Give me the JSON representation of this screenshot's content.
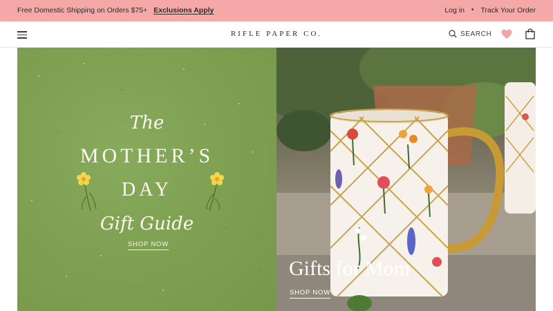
{
  "announcement": {
    "shipping_text": "Free Domestic Shipping on Orders $75+",
    "exclusions_link": "Exclusions Apply",
    "login_link": "Log in",
    "separator": "•",
    "track_order_link": "Track Your Order",
    "background_color": "#f5a8a8"
  },
  "header": {
    "logo": "RIFLE PAPER CO.",
    "search_label": "SEARCH",
    "icons": {
      "menu": "hamburger-menu-icon",
      "search": "search-icon",
      "wishlist": "heart-icon",
      "cart": "shopping-bag-icon"
    },
    "heart_color": "#f2a6a6"
  },
  "hero": {
    "left_panel": {
      "line1": "The",
      "line2": "MOTHER’S",
      "line3": "DAY",
      "line4": "Gift Guide",
      "cta": "SHOP NOW",
      "background_color": "#7fa152"
    },
    "right_panel": {
      "title": "Gifts for Mom",
      "cta": "SHOP NOW"
    }
  }
}
